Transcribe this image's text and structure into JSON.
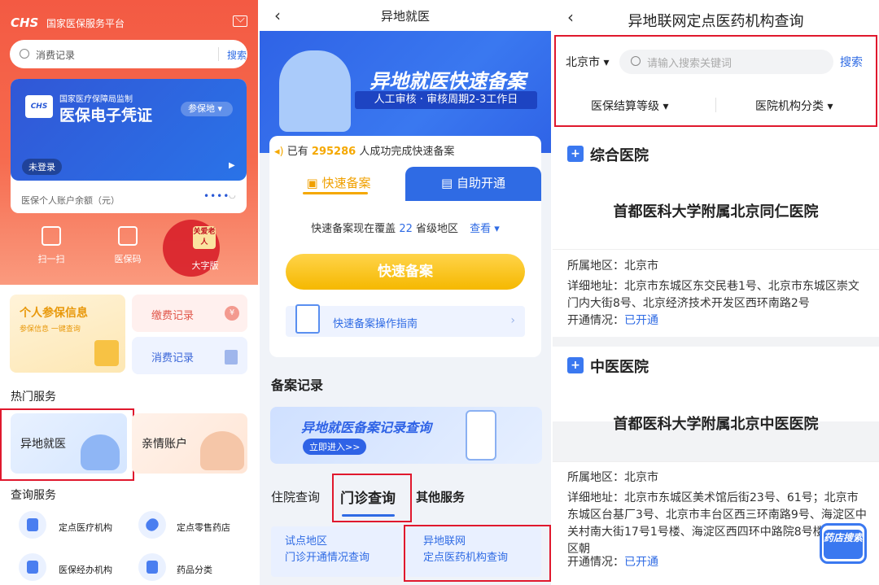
{
  "p1": {
    "logo": "CHS",
    "platform": "国家医保服务平台",
    "search_placeholder": "消费记录",
    "search_button": "搜索",
    "card_supervisor": "国家医疗保障局监制",
    "card_title": "医保电子凭证",
    "card_location": "参保地 ▾",
    "card_login": "未登录",
    "balance_label": "医保个人账户余额（元）",
    "balance_mask": "••••",
    "quick": [
      "扫一扫",
      "医保码",
      "大字版"
    ],
    "care_badge": "关爱老人",
    "cards": {
      "personal_title": "个人参保信息",
      "personal_sub": "参保信息 一键查询",
      "payment": "缴费记录",
      "consumption": "消费记录"
    },
    "hot_header": "热门服务",
    "hot": [
      "异地就医",
      "亲情账户"
    ],
    "query_header": "查询服务",
    "query": [
      "定点医疗机构",
      "定点零售药店",
      "医保经办机构",
      "药品分类"
    ]
  },
  "p2": {
    "title": "异地就医",
    "banner_title": "异地就医快速备案",
    "banner_sub": "人工审核 · 审核周期2-3工作日",
    "count_prefix": "已有",
    "count_value": "295286",
    "count_suffix": "人成功完成快速备案",
    "tab_fast": "快速备案",
    "tab_self": "自助开通",
    "coverage_prefix": "快速备案现在覆盖",
    "coverage_value": "22",
    "coverage_suffix": "省级地区",
    "coverage_link": "查看 ▾",
    "fast_button": "快速备案",
    "guide": "快速备案操作指南",
    "records_header": "备案记录",
    "records_banner": "异地就医备案记录查询",
    "records_enter": "立即进入>>",
    "tabs": [
      "住院查询",
      "门诊查询",
      "其他服务"
    ],
    "q1": [
      "试点地区",
      "门诊开通情况查询"
    ],
    "q2": [
      "异地联网",
      "定点医药机构查询"
    ]
  },
  "p3": {
    "title": "异地联网定点医药机构查询",
    "city": "北京市 ▾",
    "search_placeholder": "请输入搜索关键词",
    "search_button": "搜索",
    "filter1": "医保结算等级 ▾",
    "filter2": "医院机构分类 ▾",
    "sections": [
      {
        "category": "综合医院",
        "hospital": "首都医科大学附属北京同仁医院",
        "region": "所属地区：北京市",
        "address": "详细地址：北京市东城区东交民巷1号、北京市东城区崇文门内大街8号、北京经济技术开发区西环南路2号",
        "status_label": "开通情况：",
        "status": "已开通"
      },
      {
        "category": "中医医院",
        "hospital": "首都医科大学附属北京中医医院",
        "region": "所属地区：北京市",
        "address": "详细地址：北京市东城区美术馆后街23号、61号；北京市东城区台基厂3号、北京市丰台区西三环南路9号、海淀区中关村南大街17号1号楼、海淀区西四环中路院8号楼、朝阳区朝",
        "status_label": "开通情况：",
        "status": "已开通"
      }
    ],
    "stamp": "药店搜索"
  },
  "colors": {
    "red": "#f35a43",
    "blue": "#2f6be4",
    "gold": "#f5b800",
    "highlight": "#e0182d"
  }
}
